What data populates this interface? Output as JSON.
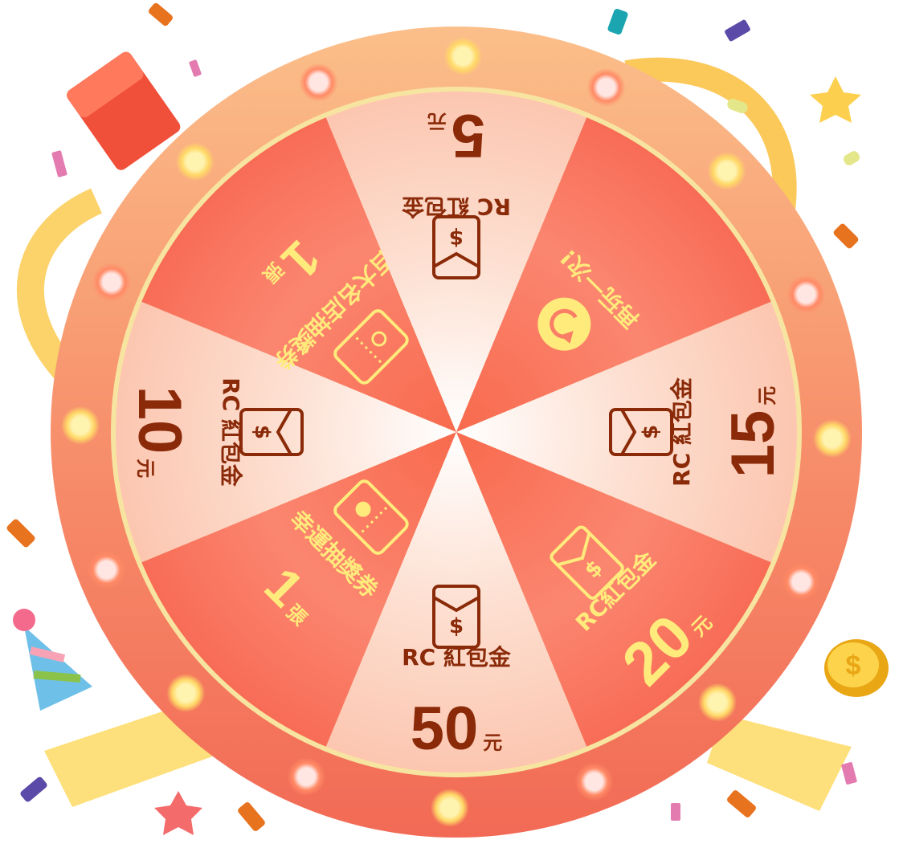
{
  "wheel": {
    "colors": {
      "ring": "#f6906b",
      "light_segment": "#fccbb6",
      "dark_segment": "#fa7e66",
      "dark_text": "#8a2a08",
      "yellow_text": "#ffea7c",
      "rim": "#f7e4a0"
    },
    "segments": [
      {
        "label": "RC 紅包金",
        "amount": "50",
        "unit": "元",
        "icon": "red-envelope-icon",
        "style": "light"
      },
      {
        "label": "幸運抽獎券",
        "amount": "1",
        "unit": "張",
        "icon": "ticket-star-icon",
        "style": "dark"
      },
      {
        "label": "RC 紅包金",
        "amount": "10",
        "unit": "元",
        "icon": "red-envelope-icon",
        "style": "light"
      },
      {
        "label": "百大名店抽獎券",
        "amount": "1",
        "unit": "張",
        "icon": "ticket-ring-icon",
        "style": "dark"
      },
      {
        "label": "RC 紅包金",
        "amount": "5",
        "unit": "元",
        "icon": "red-envelope-icon",
        "style": "light"
      },
      {
        "label": "再玩一次!",
        "amount": "",
        "unit": "",
        "icon": "replay-icon",
        "style": "dark"
      },
      {
        "label": "RC 紅包金",
        "amount": "15",
        "unit": "元",
        "icon": "red-envelope-icon",
        "style": "light"
      },
      {
        "label": "RC紅包金",
        "amount": "20",
        "unit": "元",
        "icon": "red-envelope-icon",
        "style": "dark"
      }
    ]
  }
}
